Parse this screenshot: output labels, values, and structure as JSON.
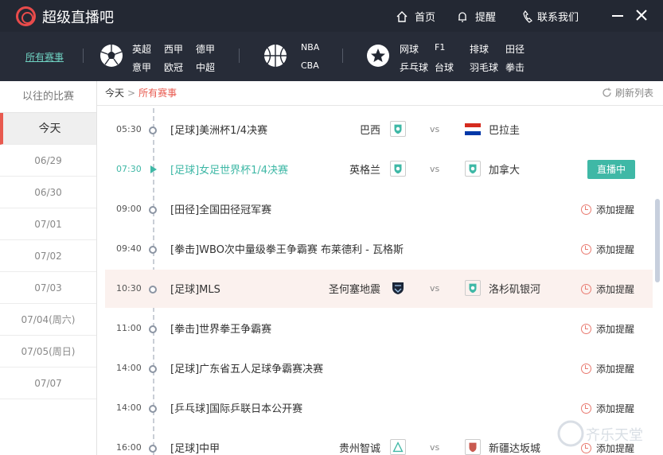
{
  "app": {
    "title": "超级直播吧"
  },
  "header": {
    "home": "首页",
    "reminder": "提醒",
    "contact": "联系我们"
  },
  "categories": {
    "all_label": "所有赛事",
    "football": [
      "英超",
      "西甲",
      "德甲",
      "意甲",
      "欧冠",
      "中超"
    ],
    "basketball": [
      "NBA",
      "CBA"
    ],
    "other": [
      "网球",
      "F1",
      "排球",
      "田径",
      "乒乓球",
      "台球",
      "羽毛球",
      "拳击"
    ]
  },
  "sidebar": {
    "past_label": "以往的比赛",
    "dates": [
      "今天",
      "06/29",
      "06/30",
      "07/01",
      "07/02",
      "07/03",
      "07/04(周六)",
      "07/05(周日)",
      "07/07"
    ]
  },
  "breadcrumb": {
    "today": "今天",
    "separator": ">",
    "current": "所有赛事"
  },
  "refresh_label": "刷新列表",
  "matches": [
    {
      "time": "05:30",
      "title": "[足球]美洲杯1/4决赛",
      "home": "巴西",
      "vs": "vs",
      "away": "巴拉圭",
      "action": "",
      "live": false
    },
    {
      "time": "07:30",
      "title": "[足球]女足世界杯1/4决赛",
      "home": "英格兰",
      "vs": "vs",
      "away": "加拿大",
      "action": "直播中",
      "live": true
    },
    {
      "time": "09:00",
      "title": "[田径]全国田径冠军赛",
      "home": "",
      "vs": "",
      "away": "",
      "action": "添加提醒",
      "live": false
    },
    {
      "time": "09:40",
      "title": "[拳击]WBO次中量级拳王争霸赛 布莱德利 - 瓦格斯",
      "home": "",
      "vs": "",
      "away": "",
      "action": "添加提醒",
      "live": false
    },
    {
      "time": "10:30",
      "title": "[足球]MLS",
      "home": "圣何塞地震",
      "vs": "vs",
      "away": "洛杉矶银河",
      "action": "添加提醒",
      "live": false
    },
    {
      "time": "11:00",
      "title": "[拳击]世界拳王争霸赛",
      "home": "",
      "vs": "",
      "away": "",
      "action": "添加提醒",
      "live": false
    },
    {
      "time": "14:00",
      "title": "[足球]广东省五人足球争霸赛决赛",
      "home": "",
      "vs": "",
      "away": "",
      "action": "添加提醒",
      "live": false
    },
    {
      "time": "14:00",
      "title": "[乒乓球]国际乒联日本公开赛",
      "home": "",
      "vs": "",
      "away": "",
      "action": "添加提醒",
      "live": false
    },
    {
      "time": "16:00",
      "title": "[足球]中甲",
      "home": "贵州智诚",
      "vs": "vs",
      "away": "新疆达坂城",
      "action": "添加提醒",
      "live": false
    }
  ],
  "watermark": {
    "text": "齐乐天堂"
  },
  "colors": {
    "titlebar": "#232833",
    "accent": "#3fb8a6",
    "active": "#e85a4f"
  }
}
